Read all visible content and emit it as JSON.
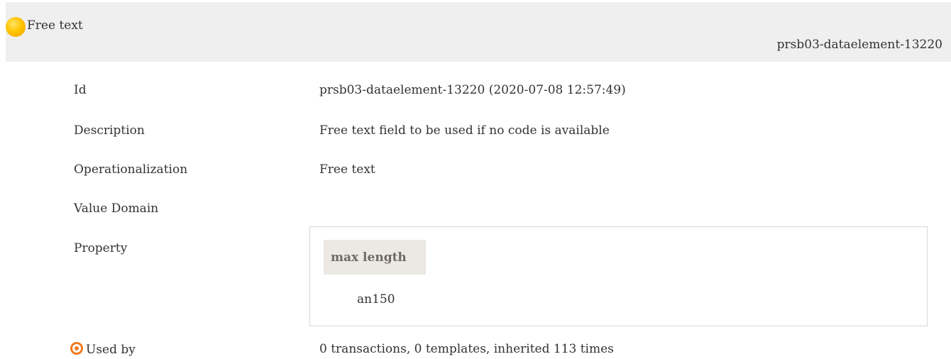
{
  "header": {
    "title": "Free text",
    "id": "prsb03-dataelement-13220",
    "status_color": "#ffc400"
  },
  "rows": {
    "id": {
      "label": "Id",
      "value": "prsb03-dataelement-13220 (2020-07-08 12:57:49)"
    },
    "description": {
      "label": "Description",
      "value": "Free text field to be used if no code is available"
    },
    "operationalization": {
      "label": "Operationalization",
      "value": "Free text"
    },
    "value_domain": {
      "label": "Value Domain",
      "value": ""
    },
    "property": {
      "label": "Property",
      "header": "max length",
      "value": "an150"
    },
    "used_by": {
      "label": "Used by",
      "value": "0 transactions, 0 templates, inherited 113 times",
      "icon": "target-icon"
    }
  }
}
